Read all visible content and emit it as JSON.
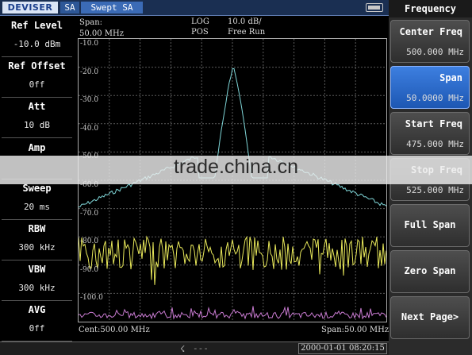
{
  "header": {
    "brand": "DEVISER",
    "mode": "SA",
    "title": "Swept SA",
    "span_label": "Span:",
    "span_value": "50.00 MHz",
    "scale_type": "LOG",
    "scale_value": "10.0 dB/",
    "detector": "POS",
    "run_mode": "Free Run"
  },
  "left_panel": [
    {
      "label": "Ref Level",
      "value": "-10.0 dBm"
    },
    {
      "label": "Ref Offset",
      "value": "0ff"
    },
    {
      "label": "Att",
      "value": "10 dB"
    },
    {
      "label": "Amp",
      "value": ""
    },
    {
      "label": "Sweep",
      "value": "20 ms"
    },
    {
      "label": "RBW",
      "value": "300 kHz"
    },
    {
      "label": "VBW",
      "value": "300 kHz"
    },
    {
      "label": "AVG",
      "value": "0ff"
    }
  ],
  "graph": {
    "y_labels": [
      "-10.0",
      "-20.0",
      "-30.0",
      "-40.0",
      "-50.0",
      "-60.0",
      "-70.0",
      "-80.0",
      "-90.0",
      "-100.0"
    ],
    "bottom_left": "Cent:500.00 MHz",
    "bottom_right": "Span:50.00 MHz",
    "trace_color_1": "#7fd6d8",
    "trace_color_2": "#e8e85a",
    "trace_color_3": "#c77ad0",
    "grid_color": "#5a5a5a"
  },
  "status": {
    "usb_icon": "usb-icon",
    "dash": "---",
    "datetime": "2000-01-01 08:20:15"
  },
  "right_panel": {
    "title": "Frequency",
    "softkeys": [
      {
        "label": "Center Freq",
        "value": "500.000 MHz"
      },
      {
        "label": "Span",
        "value": "50.0000 MHz"
      },
      {
        "label": "Start Freq",
        "value": "475.000 MHz"
      },
      {
        "label": "Stop Freq",
        "value": "525.000 MHz"
      },
      {
        "label": "Full Span",
        "value": ""
      },
      {
        "label": "Zero Span",
        "value": ""
      },
      {
        "label": "Next Page>",
        "value": ""
      }
    ]
  },
  "watermark": "trade.china.cn"
}
